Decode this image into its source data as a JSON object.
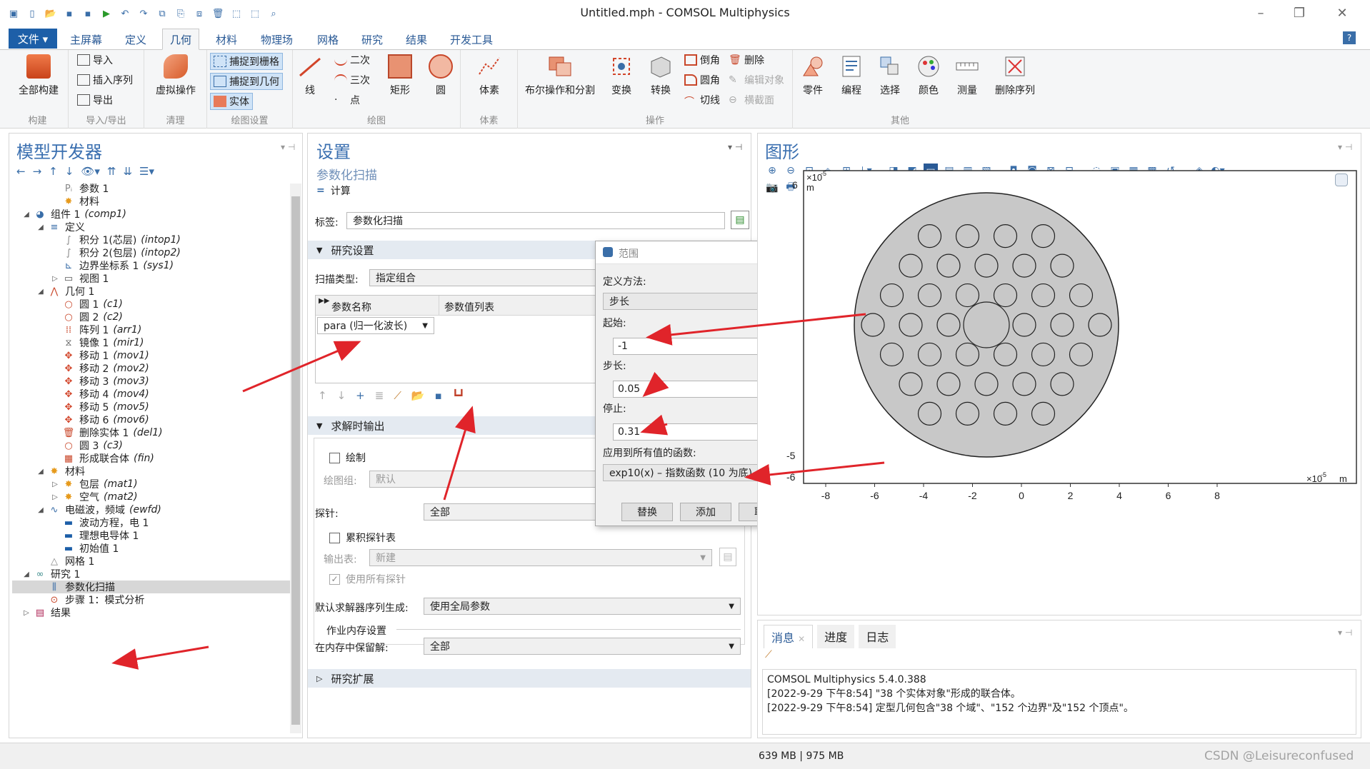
{
  "window": {
    "title": "Untitled.mph - COMSOL Multiphysics",
    "controls": [
      "minimize-icon",
      "restore-icon",
      "close-icon"
    ]
  },
  "quick_access": [
    "new-file-icon",
    "open-icon",
    "save-icon",
    "save-as-icon",
    "run-icon",
    "undo-icon",
    "redo-icon",
    "copy-icon",
    "paste-icon",
    "duplicate-icon",
    "delete-icon",
    "select-icon",
    "deselect-icon",
    "zoom-icon"
  ],
  "menu": {
    "file": "文件 ▾",
    "tabs": [
      "主屏幕",
      "定义",
      "几何",
      "材料",
      "物理场",
      "网格",
      "研究",
      "结果",
      "开发工具"
    ],
    "active_tab": "几何"
  },
  "ribbon": {
    "build_all": "全部构建",
    "group_build": "构建",
    "import": "导入",
    "insert_sequence": "插入序列",
    "export": "导出",
    "group_import_export": "导入/导出",
    "virtual_ops": "虚拟操作",
    "group_cleanup": "清理",
    "snap_grid": "捕捉到栅格",
    "snap_geometry": "捕捉到几何",
    "solid": "实体",
    "group_draw_settings": "绘图设置",
    "line": "线",
    "quadratic": "二次",
    "cubic": "三次",
    "point": "点",
    "rectangle": "矩形",
    "circle": "圆",
    "group_draw": "绘图",
    "block": "体素",
    "group_block": "体素",
    "boolean": "布尔操作和分割",
    "transform": "变换",
    "convert": "转换",
    "chamfer": "倒角",
    "fillet": "圆角",
    "tangent": "切线",
    "delete": "删除",
    "edit_object": "编辑对象",
    "cross_section": "横截面",
    "group_operations": "操作",
    "parts": "零件",
    "programming": "编程",
    "selections": "选择",
    "colors": "颜色",
    "measure": "测量",
    "delete_sequence": "删除序列",
    "group_other": "其他"
  },
  "model_builder": {
    "title": "模型开发器",
    "tree": [
      {
        "indent": 3,
        "toggle": "",
        "icon": "parameter-icon",
        "label": "参数 1",
        "tag": ""
      },
      {
        "indent": 3,
        "toggle": "",
        "icon": "material-icon",
        "label": "材料",
        "tag": ""
      },
      {
        "indent": 1,
        "toggle": "◢",
        "icon": "component-icon",
        "label": "组件 1",
        "tag": "(comp1)"
      },
      {
        "indent": 2,
        "toggle": "◢",
        "icon": "definitions-icon",
        "label": "定义",
        "tag": ""
      },
      {
        "indent": 3,
        "toggle": "",
        "icon": "integration-icon",
        "label": "积分 1(芯层)",
        "tag": "(intop1)"
      },
      {
        "indent": 3,
        "toggle": "",
        "icon": "integration-icon",
        "label": "积分 2(包层)",
        "tag": "(intop2)"
      },
      {
        "indent": 3,
        "toggle": "",
        "icon": "coordinate-system-icon",
        "label": "边界坐标系 1",
        "tag": "(sys1)"
      },
      {
        "indent": 3,
        "toggle": "▷",
        "icon": "view-icon",
        "label": "视图 1",
        "tag": ""
      },
      {
        "indent": 2,
        "toggle": "◢",
        "icon": "geometry-icon",
        "label": "几何 1",
        "tag": ""
      },
      {
        "indent": 3,
        "toggle": "",
        "icon": "circle-icon",
        "label": "圆 1",
        "tag": "(c1)"
      },
      {
        "indent": 3,
        "toggle": "",
        "icon": "circle-icon",
        "label": "圆 2",
        "tag": "(c2)"
      },
      {
        "indent": 3,
        "toggle": "",
        "icon": "array-icon",
        "label": "阵列 1",
        "tag": "(arr1)"
      },
      {
        "indent": 3,
        "toggle": "",
        "icon": "mirror-icon",
        "label": "镜像 1",
        "tag": "(mir1)"
      },
      {
        "indent": 3,
        "toggle": "",
        "icon": "move-icon",
        "label": "移动 1",
        "tag": "(mov1)"
      },
      {
        "indent": 3,
        "toggle": "",
        "icon": "move-icon",
        "label": "移动 2",
        "tag": "(mov2)"
      },
      {
        "indent": 3,
        "toggle": "",
        "icon": "move-icon",
        "label": "移动 3",
        "tag": "(mov3)"
      },
      {
        "indent": 3,
        "toggle": "",
        "icon": "move-icon",
        "label": "移动 4",
        "tag": "(mov4)"
      },
      {
        "indent": 3,
        "toggle": "",
        "icon": "move-icon",
        "label": "移动 5",
        "tag": "(mov5)"
      },
      {
        "indent": 3,
        "toggle": "",
        "icon": "move-icon",
        "label": "移动 6",
        "tag": "(mov6)"
      },
      {
        "indent": 3,
        "toggle": "",
        "icon": "delete-entities-icon",
        "label": "删除实体 1",
        "tag": "(del1)"
      },
      {
        "indent": 3,
        "toggle": "",
        "icon": "circle-icon",
        "label": "圆 3",
        "tag": "(c3)"
      },
      {
        "indent": 3,
        "toggle": "",
        "icon": "union-icon",
        "label": "形成联合体",
        "tag": "(fin)"
      },
      {
        "indent": 2,
        "toggle": "◢",
        "icon": "material-icon",
        "label": "材料",
        "tag": ""
      },
      {
        "indent": 3,
        "toggle": "▷",
        "icon": "material-icon",
        "label": "包层",
        "tag": "(mat1)"
      },
      {
        "indent": 3,
        "toggle": "▷",
        "icon": "material-icon",
        "label": "空气",
        "tag": "(mat2)"
      },
      {
        "indent": 2,
        "toggle": "◢",
        "icon": "physics-icon",
        "label": "电磁波，频域",
        "tag": "(ewfd)"
      },
      {
        "indent": 3,
        "toggle": "",
        "icon": "equation-icon",
        "label": "波动方程，电 1",
        "tag": ""
      },
      {
        "indent": 3,
        "toggle": "",
        "icon": "conductor-icon",
        "label": "理想电导体 1",
        "tag": ""
      },
      {
        "indent": 3,
        "toggle": "",
        "icon": "initial-values-icon",
        "label": "初始值 1",
        "tag": ""
      },
      {
        "indent": 2,
        "toggle": "",
        "icon": "mesh-icon",
        "label": "网格 1",
        "tag": ""
      },
      {
        "indent": 1,
        "toggle": "◢",
        "icon": "study-icon",
        "label": "研究 1",
        "tag": ""
      },
      {
        "indent": 2,
        "toggle": "",
        "icon": "parametric-sweep-icon",
        "label": "参数化扫描",
        "tag": "",
        "selected": true
      },
      {
        "indent": 2,
        "toggle": "",
        "icon": "mode-analysis-icon",
        "label": "步骤 1：模式分析",
        "tag": ""
      },
      {
        "indent": 1,
        "toggle": "▷",
        "icon": "results-icon",
        "label": "结果",
        "tag": ""
      }
    ]
  },
  "settings": {
    "title": "设置",
    "subtitle": "参数化扫描",
    "compute": "计算",
    "label_caption": "标签:",
    "label_value": "参数化扫描",
    "study_settings": "研究设置",
    "sweep_type_caption": "扫描类型:",
    "sweep_type_value": "指定组合",
    "col_param_name": "参数名称",
    "col_param_values": "参数值列表",
    "param_value": "para (归一化波长)",
    "output_section": "求解时输出",
    "plot_label": "绘制",
    "plot_group_caption": "绘图组:",
    "plot_group_value": "默认",
    "probe_caption": "探针:",
    "probe_value": "全部",
    "accumulated_probe": "累积探针表",
    "output_table_caption": "输出表:",
    "output_table_value": "新建",
    "use_all_probes": "使用所有探针",
    "default_solver_caption": "默认求解器序列生成:",
    "default_solver_value": "使用全局参数",
    "memory_settings": "作业内存设置",
    "keep_in_memory_caption": "在内存中保留解:",
    "keep_in_memory_value": "全部",
    "study_extensions": "研究扩展"
  },
  "range_dialog": {
    "title": "范围",
    "method_caption": "定义方法:",
    "method_value": "步长",
    "start_caption": "起始:",
    "start_value": "-1",
    "step_caption": "步长:",
    "step_value": "0.05",
    "stop_caption": "停止:",
    "stop_value": "0.31",
    "function_caption": "应用到所有值的函数:",
    "function_value": "exp10(x) – 指数函数 (10 为底)",
    "btn_replace": "替换",
    "btn_add": "添加",
    "btn_cancel": "取消"
  },
  "graphics": {
    "title": "图形",
    "y_exponent": "×10",
    "y_exp_power": "-5",
    "y_unit": "m",
    "x_exponent": "×10",
    "x_exp_power": "-5",
    "x_unit": "m",
    "x_ticks": [
      "-8",
      "-6",
      "-4",
      "-2",
      "0",
      "2",
      "4",
      "6",
      "8"
    ],
    "y_ticks": [
      "6",
      "-5",
      "-6"
    ],
    "small_holes": 36,
    "fill_color": "#c8c8c8"
  },
  "messages": {
    "tabs": [
      "消息",
      "进度",
      "日志"
    ],
    "lines": [
      "COMSOL Multiphysics 5.4.0.388",
      "[2022-9-29 下午8:54] \"38 个实体对象\"形成的联合体。",
      "[2022-9-29 下午8:54] 定型几何包含\"38 个域\"、\"152 个边界\"及\"152 个顶点\"。"
    ]
  },
  "status": {
    "memory": "639 MB | 975 MB",
    "watermark": "CSDN @Leisureconfused"
  },
  "colors": {
    "accent": "#1d5fa8",
    "annotation_arrow": "#e0242a"
  }
}
